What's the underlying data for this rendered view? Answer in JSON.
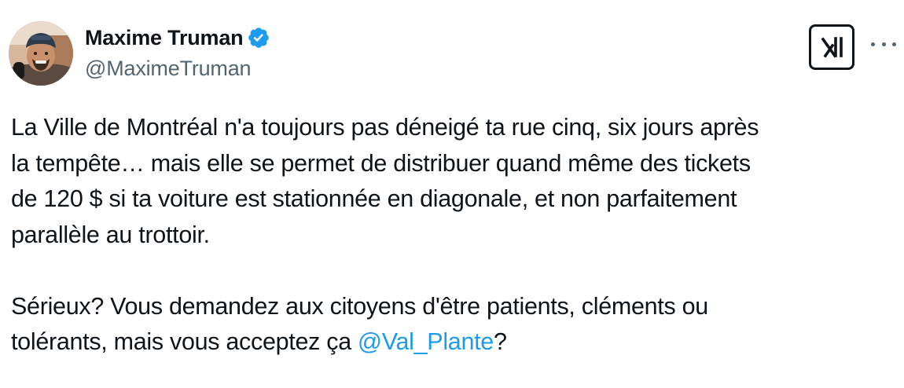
{
  "author": {
    "display_name": "Maxime Truman",
    "handle": "@MaximeTruman",
    "verified": true,
    "avatar_icon": "user-avatar-photo"
  },
  "header": {
    "brand_icon": "x-logo-icon",
    "more_icon": "more-horizontal-icon"
  },
  "tweet": {
    "paragraph_1_lines": [
      "La Ville de Montréal n'a toujours pas déneigé ta rue cinq, six jours après",
      "la tempête… mais elle se permet de distribuer quand même des tickets",
      "de 120 $ si ta voiture est stationnée en diagonale, et non parfaitement",
      "parallèle au trottoir."
    ],
    "paragraph_2_line_1": "Sérieux? Vous demandez aux citoyens d'être patients, cléments ou",
    "paragraph_2_line_2_before": "tolérants, mais vous acceptez ça ",
    "mention": "@Val_Plante",
    "paragraph_2_line_2_after": "?"
  },
  "colors": {
    "text": "#0f1419",
    "secondary": "#536471",
    "link": "#1d9bf0",
    "verified": "#1d9bf0"
  }
}
